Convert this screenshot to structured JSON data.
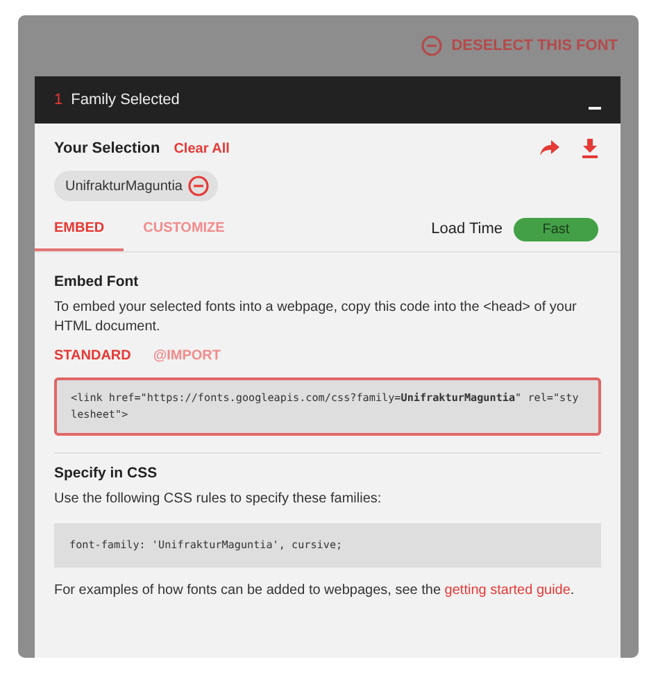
{
  "deselect_button": {
    "label": "DESELECT THIS FONT"
  },
  "drawer": {
    "count": "1",
    "title": "Family Selected",
    "selection": {
      "label": "Your Selection",
      "clear_all": "Clear All",
      "chips": [
        {
          "name": "UnifrakturMaguntia"
        }
      ]
    },
    "tabs": [
      {
        "label": "EMBED",
        "selected": true
      },
      {
        "label": "CUSTOMIZE",
        "selected": false
      }
    ],
    "load_time": {
      "label": "Load Time",
      "value": "Fast"
    },
    "embed": {
      "heading": "Embed Font",
      "description": "To embed your selected fonts into a webpage, copy this code into the <head> of your HTML document.",
      "subtabs": [
        {
          "label": "STANDARD",
          "selected": true
        },
        {
          "label": "@IMPORT",
          "selected": false
        }
      ],
      "code": "<link href=\"https://fonts.googleapis.com/css?family=**UnifrakturMaguntia**\" rel=\"stylesheet\">"
    },
    "css": {
      "heading": "Specify in CSS",
      "description": "Use the following CSS rules to specify these families:",
      "code": "font-family: 'UnifrakturMaguntia', cursive;",
      "footer_text": "For examples of how fonts can be added to webpages, see the ",
      "footer_link": "getting started guide",
      "footer_end": "."
    }
  }
}
